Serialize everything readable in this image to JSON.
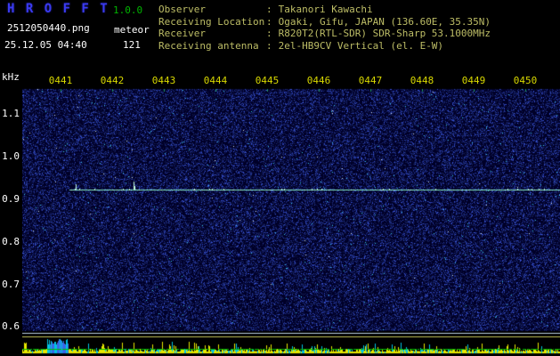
{
  "app": {
    "title": "H R O F F T",
    "version": "1.0.0",
    "filename": "2512050440.png",
    "mode": "meteor",
    "datetime": "25.12.05 04:40",
    "echo_count": "121"
  },
  "info": {
    "separator": ":",
    "rows": [
      {
        "label": "Observer",
        "value": "Takanori Kawachi"
      },
      {
        "label": "Receiving Location",
        "value": "Ogaki, Gifu, JAPAN (136.60E, 35.35N)"
      },
      {
        "label": "Receiver",
        "value": "R820T2(RTL-SDR) SDR-Sharp 53.1000MHz"
      },
      {
        "label": "Receiving antenna",
        "value": "2el-HB9CV Vertical (el. E-W)"
      }
    ]
  },
  "axes": {
    "freq_unit": "kHz",
    "freq_ticks": [
      "1.1",
      "1.0",
      "0.9",
      "0.8",
      "0.7",
      "0.6"
    ],
    "time_ticks": [
      "0441",
      "0442",
      "0443",
      "0444",
      "0445",
      "0446",
      "0447",
      "0448",
      "0449",
      "0450"
    ]
  },
  "chart_data": {
    "type": "heatmap",
    "title": "HROFFT radio meteor echo spectrogram",
    "ylabel": "kHz",
    "y_ticks_khz": [
      1.1,
      1.0,
      0.9,
      0.8,
      0.7,
      0.6
    ],
    "y_range_khz": [
      0.58,
      1.16
    ],
    "x_ticks_hhmm": [
      "0441",
      "0442",
      "0443",
      "0444",
      "0445",
      "0446",
      "0447",
      "0448",
      "0449",
      "0450"
    ],
    "x_range_hhmm": [
      "0440",
      "0450"
    ],
    "features": {
      "carrier_line_khz": 0.92,
      "carrier_line_start_hhmm": "0441",
      "carrier_line_end_hhmm": "0450",
      "boundary_lines_khz": [
        0.585,
        0.575
      ],
      "background": "random blue noise speckle",
      "bottom_strip": "signal level meter with yellow/cyan bars over green baseline",
      "echo_count": 121
    }
  },
  "colors": {
    "background": "#000000",
    "plot_bg": "#000028",
    "noise_palette": [
      "#10194e",
      "#1b2a7e",
      "#2a3fae",
      "#3a55d8"
    ],
    "noise_cyan": "#38c8e8",
    "noise_bright": "#d8e8f0",
    "tick_green": "#1f9a60",
    "carrier_line": "#84e8c0",
    "carrier_bright": "#c8ffe0",
    "boundary_line_white": "#b8cce0",
    "boundary_line_yellow": "#c2c25a",
    "bar_yellow": "#e8e800",
    "bar_cyan": "#00c4e4",
    "bar_blue": "#3a66e8",
    "baseline_green": "#00c000",
    "title_blue": "#3a3af0",
    "version_green": "#00b400",
    "header_white": "#ffffff",
    "info_text": "#bdbd66",
    "time_label_yellow": "#d8d800",
    "freq_label_white": "#ffffff"
  }
}
